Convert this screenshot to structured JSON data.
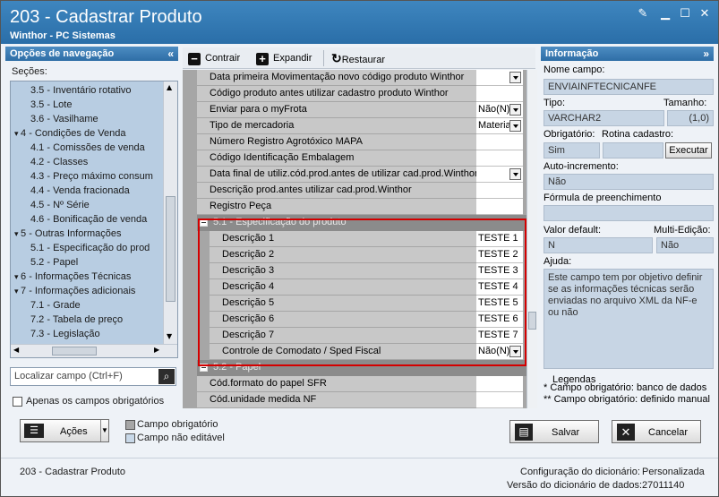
{
  "window": {
    "title": "203 - Cadastrar  Produto",
    "subtitle": "Winthor - PC Sistemas"
  },
  "nav": {
    "header": "Opções de navegação",
    "sections_label": "Seções:",
    "items": [
      {
        "label": "3.5 - Inventário rotativo",
        "level": 2
      },
      {
        "label": "3.5 - Lote",
        "level": 2
      },
      {
        "label": "3.6 - Vasilhame",
        "level": 2
      },
      {
        "label": "4 - Condições de Venda",
        "level": 1
      },
      {
        "label": "4.1 - Comissões de venda",
        "level": 2
      },
      {
        "label": "4.2 - Classes",
        "level": 2
      },
      {
        "label": "4.3 - Preço máximo consum",
        "level": 2
      },
      {
        "label": "4.4 - Venda fracionada",
        "level": 2
      },
      {
        "label": "4.5 - Nº Série",
        "level": 2
      },
      {
        "label": "4.6 - Bonificação de venda",
        "level": 2
      },
      {
        "label": "5 - Outras Informações",
        "level": 1
      },
      {
        "label": "5.1 - Especificação do prod",
        "level": 2
      },
      {
        "label": "5.2 - Papel",
        "level": 2
      },
      {
        "label": "6 - Informações Técnicas",
        "level": 1
      },
      {
        "label": "7 - Informações adicionais",
        "level": 1
      },
      {
        "label": "7.1 - Grade",
        "level": 2
      },
      {
        "label": "7.2 - Tabela de preço",
        "level": 2
      },
      {
        "label": "7.3 - Legislação",
        "level": 2
      }
    ],
    "search_placeholder": "Localizar campo (Ctrl+F)",
    "only_required_label": "Apenas os campos obrigatórios"
  },
  "toolbar": {
    "collapse": "Contrair",
    "expand": "Expandir",
    "restore": "Restaurar"
  },
  "grid": {
    "rows_top": [
      {
        "label": "Data primeira Movimentação novo código produto Winthor",
        "value": "",
        "dropdown": true
      },
      {
        "label": "Código produto antes utilizar cadastro produto Winthor",
        "value": "",
        "dropdown": false
      },
      {
        "label": "Enviar para o myFrota",
        "value": "Não(N)",
        "dropdown": true
      },
      {
        "label": "Tipo de mercadoria",
        "value": "Materia",
        "dropdown": true
      },
      {
        "label": "Número Registro Agrotóxico MAPA",
        "value": "",
        "dropdown": false
      },
      {
        "label": "Código Identificação Embalagem",
        "value": "",
        "dropdown": false
      },
      {
        "label": "Data final de utiliz.cód.prod.antes de utilizar cad.prod.Winthor",
        "value": "",
        "dropdown": true
      },
      {
        "label": "Descrição prod.antes utilizar cad.prod.Winthor",
        "value": "",
        "dropdown": false
      },
      {
        "label": "Registro Peça",
        "value": "",
        "dropdown": false
      }
    ],
    "section1": "5.1 - Especificação do produto",
    "rows_s1": [
      {
        "label": "Descrição 1",
        "value": "TESTE 1",
        "dropdown": false
      },
      {
        "label": "Descrição 2",
        "value": "TESTE 2",
        "dropdown": false
      },
      {
        "label": "Descrição 3",
        "value": "TESTE 3",
        "dropdown": false
      },
      {
        "label": "Descrição 4",
        "value": "TESTE 4",
        "dropdown": false
      },
      {
        "label": "Descrição 5",
        "value": "TESTE 5",
        "dropdown": false
      },
      {
        "label": "Descrição 6",
        "value": "TESTE 6",
        "dropdown": false
      },
      {
        "label": "Descrição 7",
        "value": "TESTE 7",
        "dropdown": false
      },
      {
        "label": "Controle de Comodato / Sped Fiscal",
        "value": "Não(N)",
        "dropdown": true
      }
    ],
    "section2": "5.2 - Papel",
    "rows_s2": [
      {
        "label": "Cód.formato do papel SFR",
        "value": "",
        "dropdown": false
      },
      {
        "label": "Cód.unidade medida NF",
        "value": "",
        "dropdown": false
      }
    ]
  },
  "info": {
    "header": "Informação",
    "field_name_label": "Nome campo:",
    "field_name": "ENVIAINFTECNICANFE",
    "type_label": "Tipo:",
    "type": "VARCHAR2",
    "size_label": "Tamanho:",
    "size": "(1,0)",
    "required_label": "Obrigatório:",
    "required": "Sim",
    "routine_label": "Rotina cadastro:",
    "execute": "Executar",
    "autoinc_label": "Auto-incremento:",
    "autoinc": "Não",
    "formula_label": "Fórmula de preenchimento",
    "formula": "",
    "default_label": "Valor default:",
    "default": "N",
    "multi_label": "Multi-Edição:",
    "multi": "Não",
    "help_label": "Ajuda:",
    "help": "Este campo tem por objetivo definir se as informações técnicas serão enviadas no arquivo XML da NF-e ou não",
    "legend_title": "Legendas",
    "legend_1": "* Campo obrigatório: banco de dados",
    "legend_2": "** Campo obrigatório: definido manual"
  },
  "bottom": {
    "actions": "Ações",
    "legend_required": "Campo obrigatório",
    "legend_noedit": "Campo não editável",
    "save": "Salvar",
    "cancel": "Cancelar"
  },
  "footer": {
    "app": "203 - Cadastrar  Produto",
    "dict_config_label": "Configuração do dicionário:",
    "dict_config": "Personalizada",
    "dict_version_label": "Versão do dicionário de dados:",
    "dict_version": "27011140"
  }
}
